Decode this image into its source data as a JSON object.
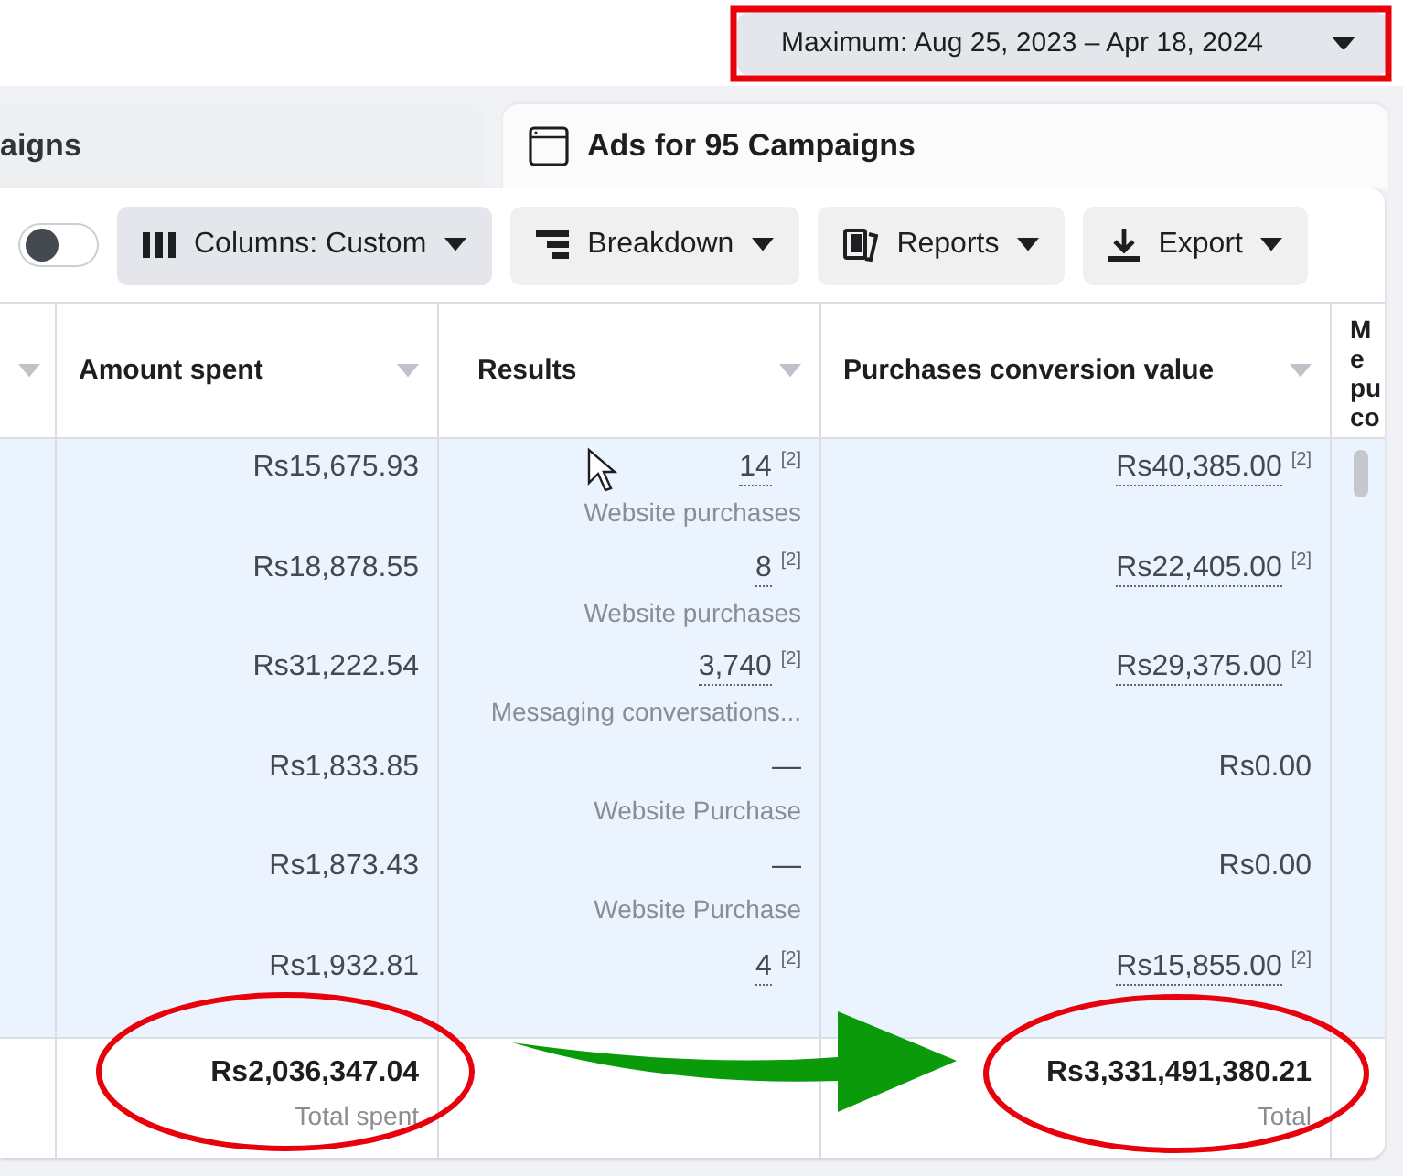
{
  "date_range": {
    "label": "Maximum: Aug 25, 2023 – Apr 18, 2024"
  },
  "tabs": [
    {
      "label": "aigns",
      "selected": false,
      "icon": false
    },
    {
      "label": "Ads for 95 Campaigns",
      "selected": true,
      "icon": true
    }
  ],
  "toolbar": {
    "toggle": {
      "on": false
    },
    "buttons": [
      {
        "label": "Columns: Custom",
        "kind": "columns",
        "active": true
      },
      {
        "label": "Breakdown",
        "kind": "breakdown",
        "active": false
      },
      {
        "label": "Reports",
        "kind": "reports",
        "active": false
      },
      {
        "label": "Export",
        "kind": "export",
        "active": false
      }
    ]
  },
  "table": {
    "columns": [
      {
        "label": "Amount spent"
      },
      {
        "label": "Results"
      },
      {
        "label": "Purchases conversion value"
      },
      {
        "label": "Me pu co"
      }
    ],
    "rows": [
      {
        "amount": "Rs15,675.93",
        "result": "14",
        "result_ref": "[2]",
        "result_label": "Website purchases",
        "value": "Rs40,385.00",
        "value_ref": "[2]"
      },
      {
        "amount": "Rs18,878.55",
        "result": "8",
        "result_ref": "[2]",
        "result_label": "Website purchases",
        "value": "Rs22,405.00",
        "value_ref": "[2]"
      },
      {
        "amount": "Rs31,222.54",
        "result": "3,740",
        "result_ref": "[2]",
        "result_label": "Messaging conversations...",
        "value": "Rs29,375.00",
        "value_ref": "[2]"
      },
      {
        "amount": "Rs1,833.85",
        "result": "—",
        "result_label": "Website Purchase",
        "value": "Rs0.00"
      },
      {
        "amount": "Rs1,873.43",
        "result": "—",
        "result_label": "Website Purchase",
        "value": "Rs0.00"
      },
      {
        "amount": "Rs1,932.81",
        "result": "4",
        "result_ref": "[2]",
        "value": "Rs15,855.00",
        "value_ref": "[2]"
      }
    ],
    "totals": {
      "amount": "Rs2,036,347.04",
      "amount_label": "Total spent",
      "value": "Rs3,331,491,380.21",
      "value_label": "Total"
    }
  }
}
